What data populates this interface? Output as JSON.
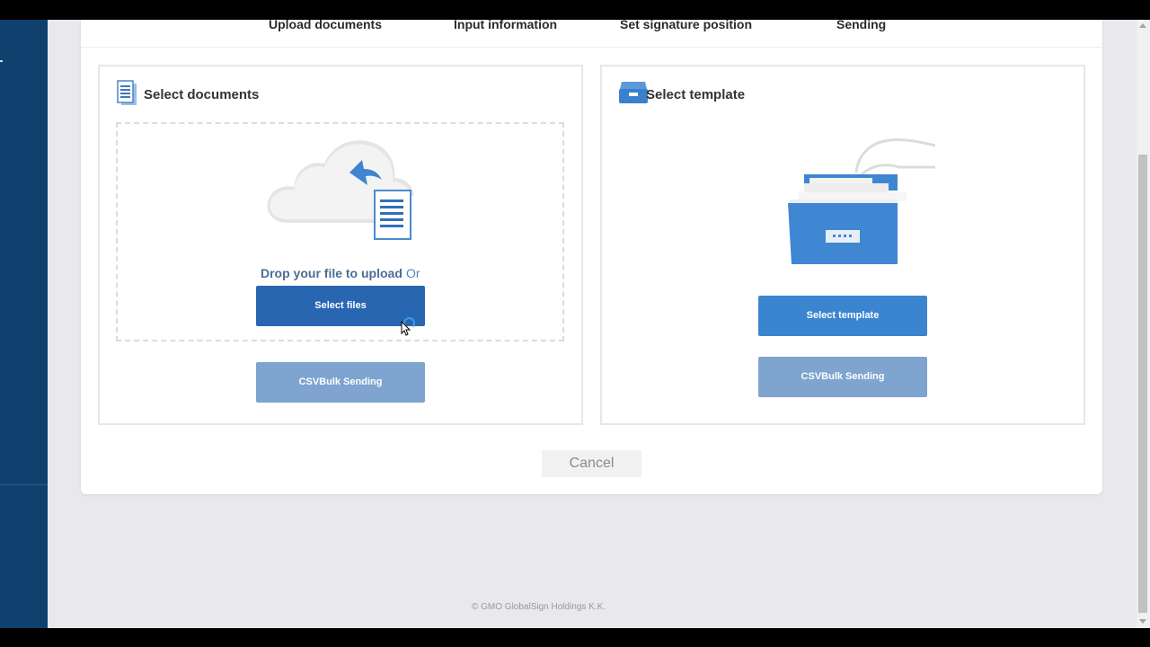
{
  "steps": [
    "Upload documents",
    "Input information",
    "Set signature position",
    "Sending"
  ],
  "documents": {
    "title": "Select documents",
    "drop_text": "Drop your file to upload",
    "or_text": "Or",
    "select_files_label": "Select files",
    "csv_label": "CSVBulk Sending"
  },
  "template": {
    "title": "Select template",
    "select_template_label": "Select template",
    "csv_label": "CSVBulk Sending"
  },
  "cancel_label": "Cancel",
  "footer": "© GMO GlobalSign Holdings K.K.",
  "colors": {
    "sidebar": "#0f406e",
    "primary_button": "#2866b2",
    "template_button": "#3b85d0",
    "disabled_button": "#7ea4cf"
  }
}
